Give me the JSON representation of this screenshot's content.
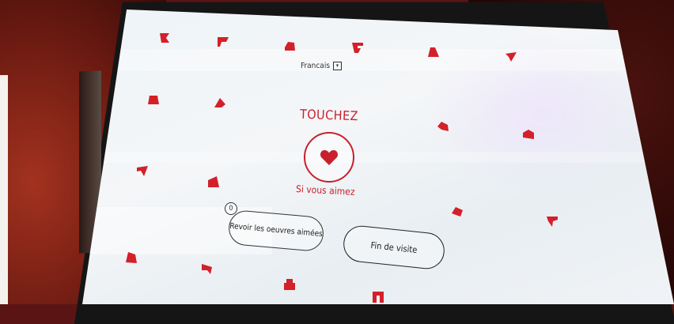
{
  "language": {
    "label": "Francais",
    "dropdown_glyph": "▾"
  },
  "prompt": {
    "title": "TOUCHEZ",
    "subtitle": "Si vous aimez"
  },
  "like_button": {
    "icon": "heart-icon"
  },
  "liked_count": "0",
  "buttons": {
    "review_liked": "Revoir les oeuvres aimées",
    "end_visit": "Fin de visite"
  },
  "colors": {
    "accent": "#c8202c",
    "screen_bg": "#f0f4f7",
    "text": "#222222"
  }
}
